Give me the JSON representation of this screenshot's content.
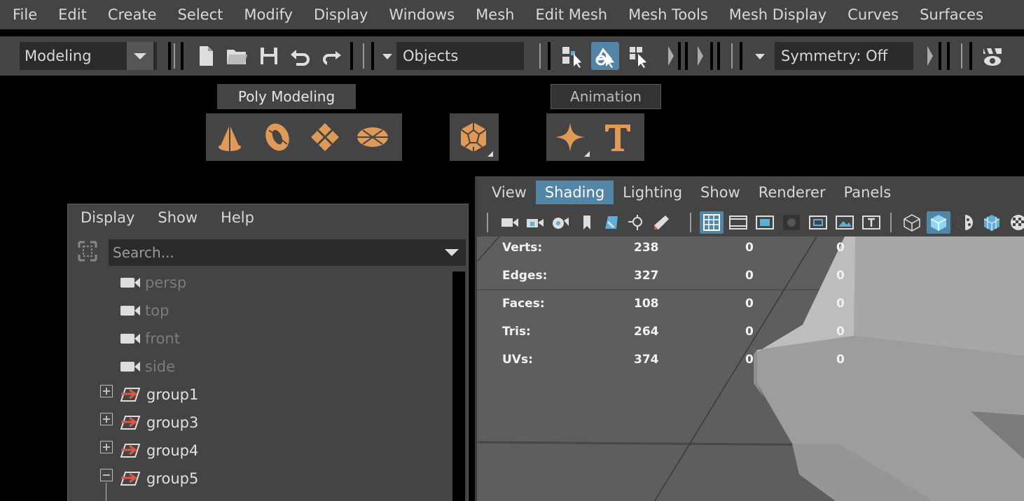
{
  "menubar": [
    "File",
    "Edit",
    "Create",
    "Select",
    "Modify",
    "Display",
    "Windows",
    "Mesh",
    "Edit Mesh",
    "Mesh Tools",
    "Mesh Display",
    "Curves",
    "Surfaces"
  ],
  "toolbar": {
    "menuset": "Modeling",
    "selection_mode": "Objects",
    "symmetry": "Symmetry: Off"
  },
  "shelf": {
    "tabs": [
      "Poly Modeling",
      "Animation"
    ],
    "accent": "#e09a57"
  },
  "outliner": {
    "menu": [
      "Display",
      "Show",
      "Help"
    ],
    "search_placeholder": "Search...",
    "items": [
      {
        "label": "persp",
        "icon": "camera-icon",
        "dim": true
      },
      {
        "label": "top",
        "icon": "camera-icon",
        "dim": true
      },
      {
        "label": "front",
        "icon": "camera-icon",
        "dim": true
      },
      {
        "label": "side",
        "icon": "camera-icon",
        "dim": true
      },
      {
        "label": "group1",
        "icon": "group-icon",
        "expanded": false
      },
      {
        "label": "group3",
        "icon": "group-icon",
        "expanded": false
      },
      {
        "label": "group4",
        "icon": "group-icon",
        "expanded": false
      },
      {
        "label": "group5",
        "icon": "group-icon",
        "expanded": true
      }
    ]
  },
  "viewport": {
    "menu": [
      "View",
      "Shading",
      "Lighting",
      "Show",
      "Renderer",
      "Panels"
    ],
    "active_menu": "Shading",
    "hud": [
      {
        "label": "Verts:",
        "total": "238",
        "selected": "0",
        "component": "0"
      },
      {
        "label": "Edges:",
        "total": "327",
        "selected": "0",
        "component": "0"
      },
      {
        "label": "Faces:",
        "total": "108",
        "selected": "0",
        "component": "0"
      },
      {
        "label": "Tris:",
        "total": "264",
        "selected": "0",
        "component": "0"
      },
      {
        "label": "UVs:",
        "total": "374",
        "selected": "0",
        "component": "0"
      }
    ]
  }
}
